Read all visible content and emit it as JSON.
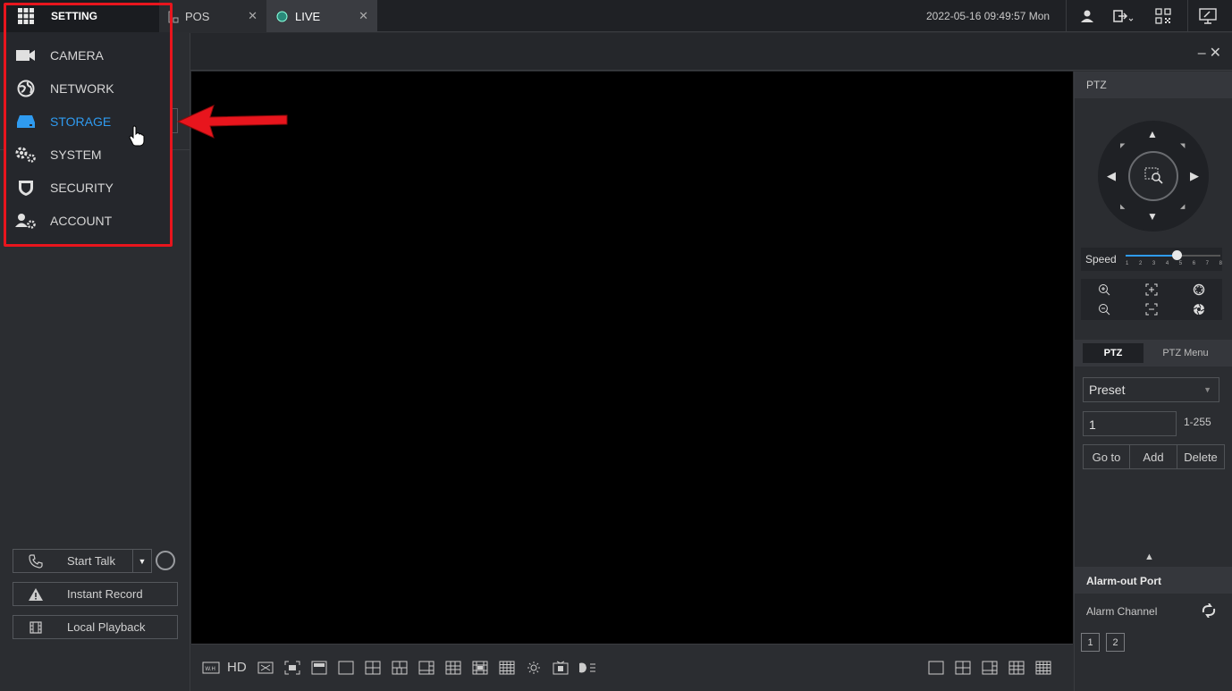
{
  "tabs": {
    "setting": "SETTING",
    "pos": "POS",
    "live": "LIVE"
  },
  "datetime": "2022-05-16 09:49:57 Mon",
  "menu": {
    "items": [
      {
        "label": "CAMERA",
        "icon": "camera-icon"
      },
      {
        "label": "NETWORK",
        "icon": "network-icon"
      },
      {
        "label": "STORAGE",
        "icon": "storage-icon",
        "active": true
      },
      {
        "label": "SYSTEM",
        "icon": "system-icon"
      },
      {
        "label": "SECURITY",
        "icon": "security-icon"
      },
      {
        "label": "ACCOUNT",
        "icon": "account-icon"
      }
    ]
  },
  "left_buttons": {
    "start_talk": "Start Talk",
    "instant_record": "Instant Record",
    "local_playback": "Local Playback"
  },
  "bottom_tools": {
    "hd": "HD"
  },
  "ptz": {
    "header": "PTZ",
    "speed_label": "Speed",
    "speed_ticks": [
      "1",
      "2",
      "3",
      "4",
      "5",
      "6",
      "7",
      "8"
    ],
    "speed_value": 5,
    "tab_ptz": "PTZ",
    "tab_ptz_menu": "PTZ Menu",
    "preset_select": "Preset",
    "preset_number": "1",
    "preset_range": "1-255",
    "goto": "Go to",
    "add": "Add",
    "delete": "Delete"
  },
  "alarm": {
    "header": "Alarm-out Port",
    "channel_label": "Alarm Channel",
    "channels": [
      "1",
      "2"
    ]
  },
  "colors": {
    "accent": "#2f9bf0",
    "highlight_red": "#e8151d"
  }
}
